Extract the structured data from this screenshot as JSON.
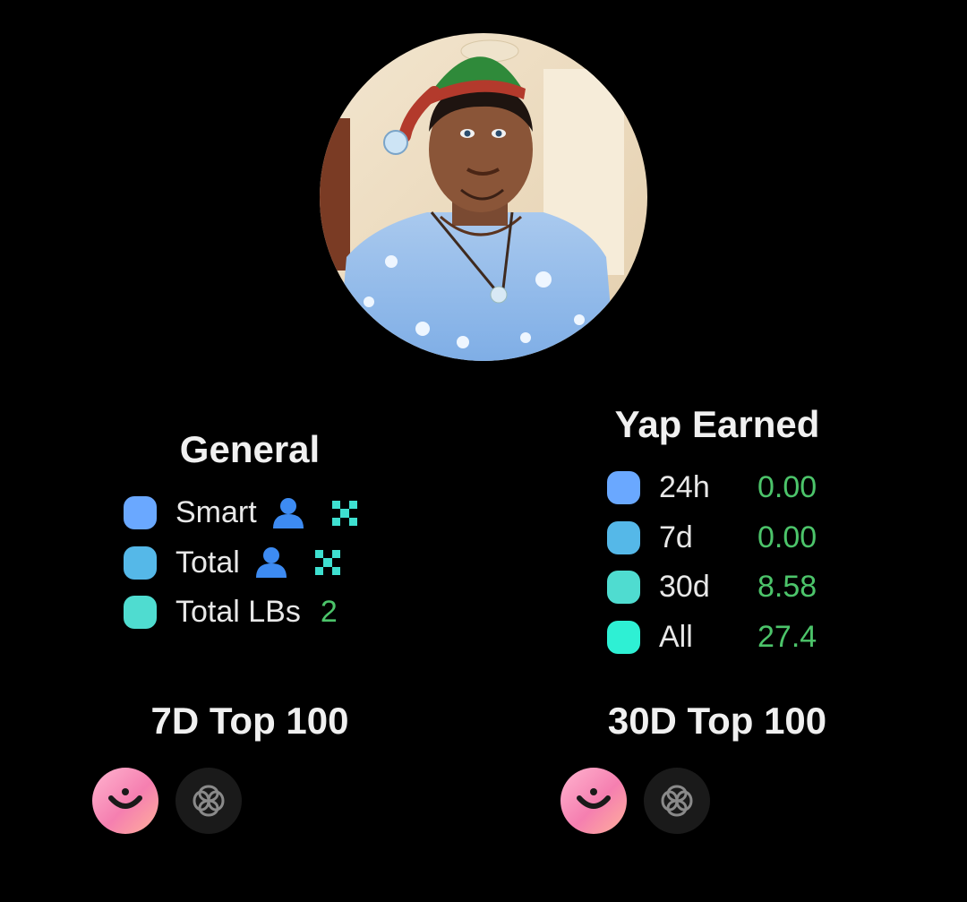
{
  "profile": {
    "avatar_alt": "avatar"
  },
  "general": {
    "title": "General",
    "rows": [
      {
        "label": "Smart",
        "value": "",
        "color": "#6aa8ff"
      },
      {
        "label": "Total",
        "value": "",
        "color": "#55b8e8"
      },
      {
        "label": "Total LBs",
        "value": "2",
        "color": "#4fdcd0"
      }
    ]
  },
  "yap_earned": {
    "title": "Yap Earned",
    "rows": [
      {
        "period": "24h",
        "value": "0.00",
        "color": "#6aa8ff"
      },
      {
        "period": "7d",
        "value": "0.00",
        "color": "#55b8e8"
      },
      {
        "period": "30d",
        "value": "8.58",
        "color": "#4fdcd0"
      },
      {
        "period": "All",
        "value": "27.4",
        "color": "#2ef0d4"
      }
    ]
  },
  "top_7d": {
    "title": "7D Top 100",
    "badges": [
      "kaito-smile-icon",
      "knot-icon"
    ]
  },
  "top_30d": {
    "title": "30D Top 100",
    "badges": [
      "kaito-smile-icon",
      "knot-icon"
    ]
  },
  "colors": {
    "value_green": "#4cc46a",
    "x_icon_teal": "#3ee0d0",
    "user_icon_blue": "#3d8bf2"
  }
}
